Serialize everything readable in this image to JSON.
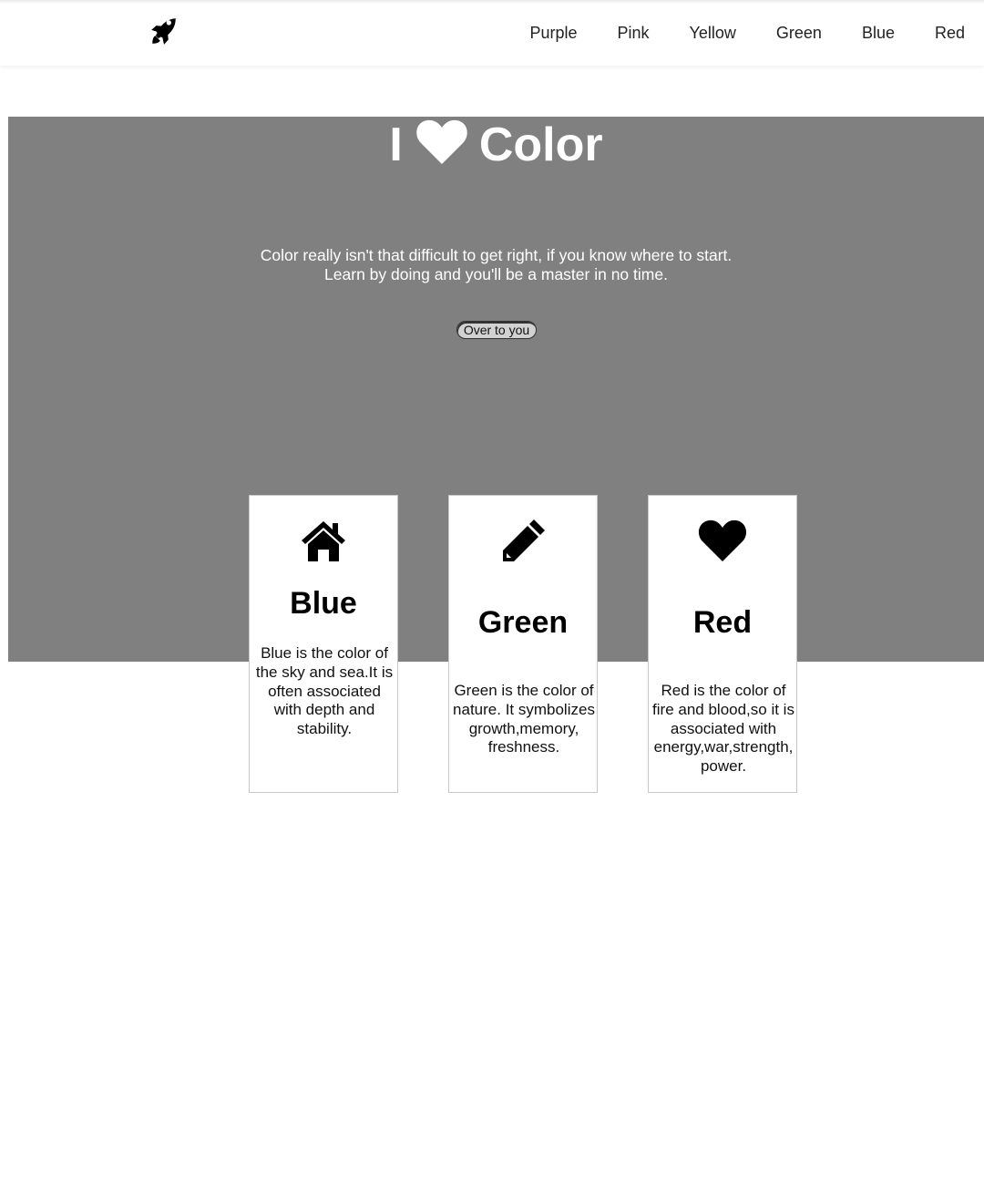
{
  "nav": {
    "logo_icon": "rocket-icon",
    "items": [
      "Purple",
      "Pink",
      "Yellow",
      "Green",
      "Blue",
      "Red"
    ]
  },
  "hero": {
    "title_left": "I",
    "title_icon": "heart-icon",
    "title_right": "Color",
    "subtitle_line1": "Color really isn't that difficult to get right, if you know where to start.",
    "subtitle_line2": "Learn by doing and you'll be a master in no time.",
    "button_label": "Over to you",
    "background_color": "#808080"
  },
  "cards": [
    {
      "icon": "home-icon",
      "title": "Blue",
      "text": "Blue is the color of the sky and sea.It is often associated with depth and stability."
    },
    {
      "icon": "pencil-icon",
      "title": "Green",
      "text": "Green is the color of nature. It symbolizes growth,memory, freshness."
    },
    {
      "icon": "heart-icon",
      "title": "Red",
      "text": "Red is the color of fire and blood,so it is associated with energy,war,strength, power."
    }
  ]
}
